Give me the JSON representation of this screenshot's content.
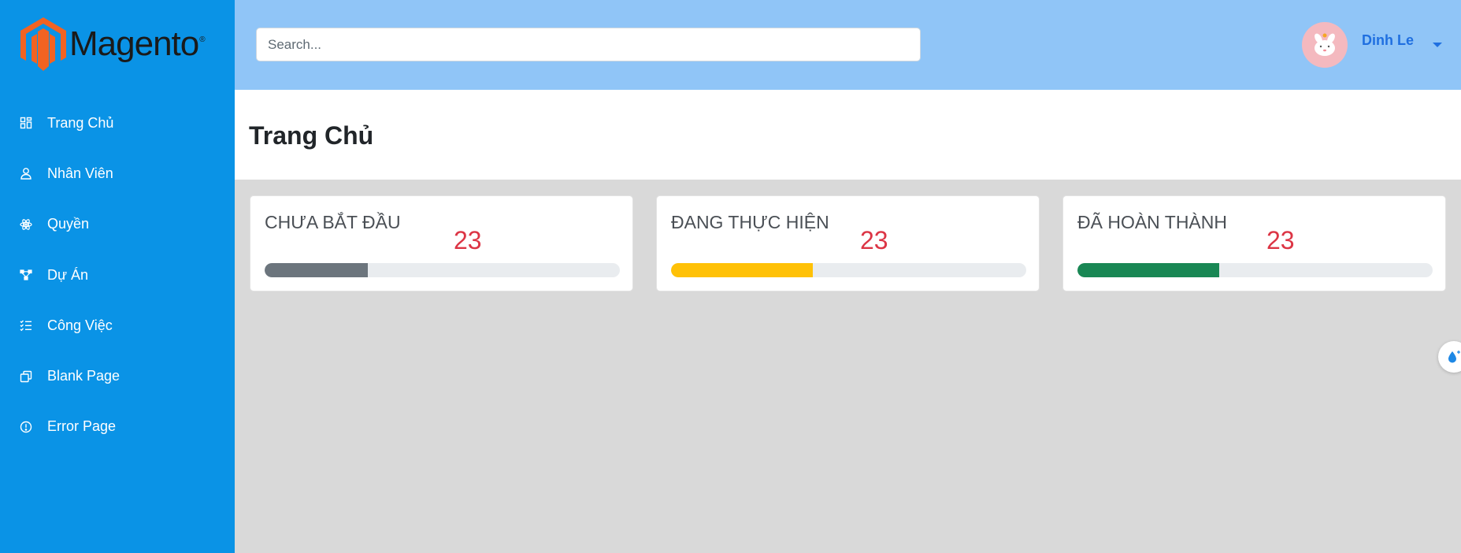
{
  "brand": {
    "name": "Magento",
    "reg": "®",
    "accent": "#f26322"
  },
  "sidebar": {
    "items": [
      {
        "label": "Trang Chủ",
        "icon": "dashboard-grid-icon"
      },
      {
        "label": "Nhân Viên",
        "icon": "person-icon"
      },
      {
        "label": "Quyền",
        "icon": "atom-icon"
      },
      {
        "label": "Dự Án",
        "icon": "diagram-icon"
      },
      {
        "label": "Công Việc",
        "icon": "checklist-icon"
      },
      {
        "label": "Blank Page",
        "icon": "copy-pages-icon"
      },
      {
        "label": "Error Page",
        "icon": "exclamation-circle-icon"
      }
    ]
  },
  "header": {
    "search_placeholder": "Search...",
    "user_name": "Dinh Le"
  },
  "page": {
    "title": "Trang Chủ"
  },
  "cards": [
    {
      "title": "CHƯA BẮT ĐẦU",
      "value": "23",
      "progress": 0.29,
      "color": "#6c757d"
    },
    {
      "title": "ĐANG THỰC HIỆN",
      "value": "23",
      "progress": 0.4,
      "color": "#ffc107"
    },
    {
      "title": "ĐÃ HOÀN THÀNH",
      "value": "23",
      "progress": 0.4,
      "color": "#198754"
    }
  ],
  "colors": {
    "sidebar": "#0a93e6",
    "header": "#90c5f7",
    "value_red": "#dc3545"
  }
}
